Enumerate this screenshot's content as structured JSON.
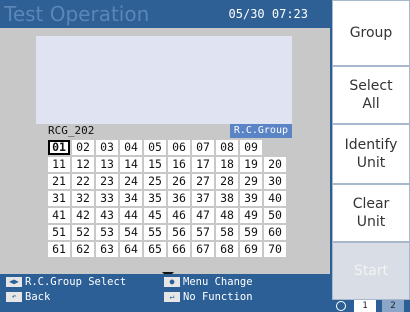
{
  "header": {
    "title": "Test Operation",
    "datetime": "05/30 07:23"
  },
  "group": {
    "name": "RCG_202",
    "tag": "R.C.Group"
  },
  "grid": {
    "rows": [
      [
        "01",
        "02",
        "03",
        "04",
        "05",
        "06",
        "07",
        "08",
        "09",
        ""
      ],
      [
        "11",
        "12",
        "13",
        "14",
        "15",
        "16",
        "17",
        "18",
        "19",
        "20"
      ],
      [
        "21",
        "22",
        "23",
        "24",
        "25",
        "26",
        "27",
        "28",
        "29",
        "30"
      ],
      [
        "31",
        "32",
        "33",
        "34",
        "35",
        "36",
        "37",
        "38",
        "39",
        "40"
      ],
      [
        "41",
        "42",
        "43",
        "44",
        "45",
        "46",
        "47",
        "48",
        "49",
        "50"
      ],
      [
        "51",
        "52",
        "53",
        "54",
        "55",
        "56",
        "57",
        "58",
        "59",
        "60"
      ],
      [
        "61",
        "62",
        "63",
        "64",
        "65",
        "66",
        "67",
        "68",
        "69",
        "70"
      ]
    ],
    "selected": "01"
  },
  "footer": {
    "rc_group_select": "R.C.Group Select",
    "back": "Back",
    "menu_change": "Menu Change",
    "no_function": "No Function"
  },
  "buttons": {
    "group": "Group",
    "select_all": "Select\nAll",
    "identify_unit": "Identify\nUnit",
    "clear_unit": "Clear\nUnit",
    "start": "Start"
  },
  "pager": {
    "page1": "1",
    "page2": "2"
  }
}
